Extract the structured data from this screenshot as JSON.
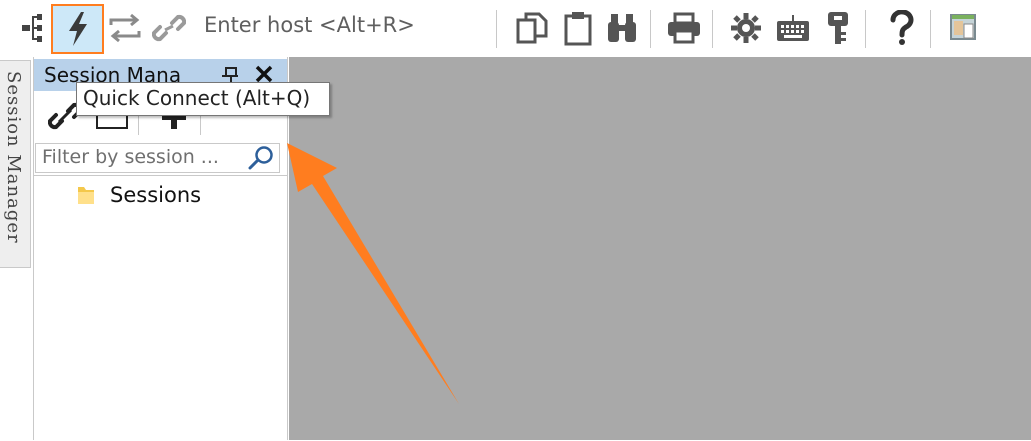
{
  "toolbar": {
    "host_placeholder": "Enter host <Alt+R>"
  },
  "side_tab": {
    "label": "Session Manager"
  },
  "session_panel": {
    "title": "Session Mana",
    "filter_placeholder": "Filter by session ...",
    "tree": [
      {
        "label": "Sessions",
        "icon": "folder-icon"
      }
    ]
  },
  "tooltip": {
    "text": "Quick Connect (Alt+Q)"
  },
  "colors": {
    "highlight_border": "#ff7d1f",
    "highlight_fill": "#cde8f8",
    "annotation_arrow": "#ff7d1f",
    "workspace": "#a9a9a9",
    "panel_header": "#b8d1ea"
  }
}
